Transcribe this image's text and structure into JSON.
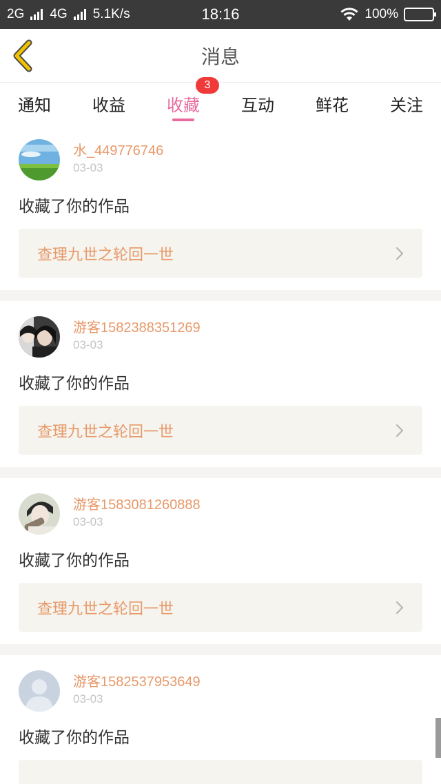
{
  "status_bar": {
    "network_1": "2G",
    "network_2": "4G",
    "speed": "5.1K/s",
    "time": "18:16",
    "battery": "100%",
    "battery_level_percent": 100
  },
  "header": {
    "title": "消息",
    "back_icon": "chevron-left-icon",
    "back_color": "#f2c200"
  },
  "tabs": [
    {
      "label": "通知"
    },
    {
      "label": "收益"
    },
    {
      "label": "收藏",
      "badge": "3",
      "active": true
    },
    {
      "label": "互动"
    },
    {
      "label": "鲜花"
    },
    {
      "label": "关注"
    }
  ],
  "accent_color": "#e86a9e",
  "feed": [
    {
      "username": "水_449776746",
      "date": "03-03",
      "action": "收藏了你的作品",
      "work": "查理九世之轮回一世",
      "avatar": "landscape"
    },
    {
      "username": "游客1582388351269",
      "date": "03-03",
      "action": "收藏了你的作品",
      "work": "查理九世之轮回一世",
      "avatar": "dark-portrait"
    },
    {
      "username": "游客1583081260888",
      "date": "03-03",
      "action": "收藏了你的作品",
      "work": "查理九世之轮回一世",
      "avatar": "light-portrait"
    },
    {
      "username": "游客1582537953649",
      "date": "03-03",
      "action": "收藏了你的作品",
      "work": "",
      "avatar": "default-user"
    }
  ]
}
